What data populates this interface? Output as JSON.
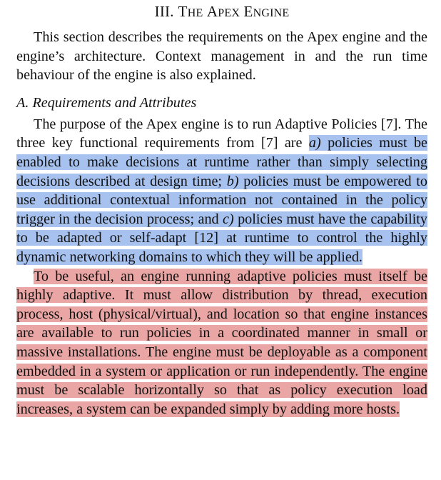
{
  "section": {
    "number": "III.",
    "title_first_letter_1": "T",
    "title_rest_1": "he",
    "title_first_letter_2": "A",
    "title_rest_2": "pex",
    "title_first_letter_3": "E",
    "title_rest_3": "ngine"
  },
  "intro": "This section describes the requirements on the Apex engine and the engine’s architecture. Context management in and the run time behaviour of the engine is also explained.",
  "subsection": {
    "label": "A.",
    "title": "Requirements and Attributes"
  },
  "paragraph1": {
    "pre_highlight": "The purpose of the Apex engine is to run Adaptive Policies [7]. The three key functional requirements from [7] are ",
    "item_a_marker": "a)",
    "item_a_text": " policies must be enabled to make decisions at runtime rather than simply selecting decisions described at design time; ",
    "item_b_marker": "b)",
    "item_b_text": " policies must be empowered to use additional contextual information not contained in the policy trigger in the decision process; and ",
    "item_c_marker": "c)",
    "item_c_text": " policies must have the capability to be adapted or self-adapt [12] at runtime to control the highly dynamic networking domains to which they will be applied."
  },
  "paragraph2": {
    "text": "To be useful, an engine running adaptive policies must itself be highly adaptive. It must allow distribution by thread, execution process, host (physical/virtual), and location so that engine instances are available to run policies in a coordinated manner in small or massive installations. The engine must be deployable as a component embedded in a system or application or run independently. The engine must be scalable horizontally so that as policy execution load increases, a system can be expanded simply by adding more hosts."
  },
  "colors": {
    "highlight_blue": "#a7c2ef",
    "highlight_red": "#eaa6a4"
  }
}
